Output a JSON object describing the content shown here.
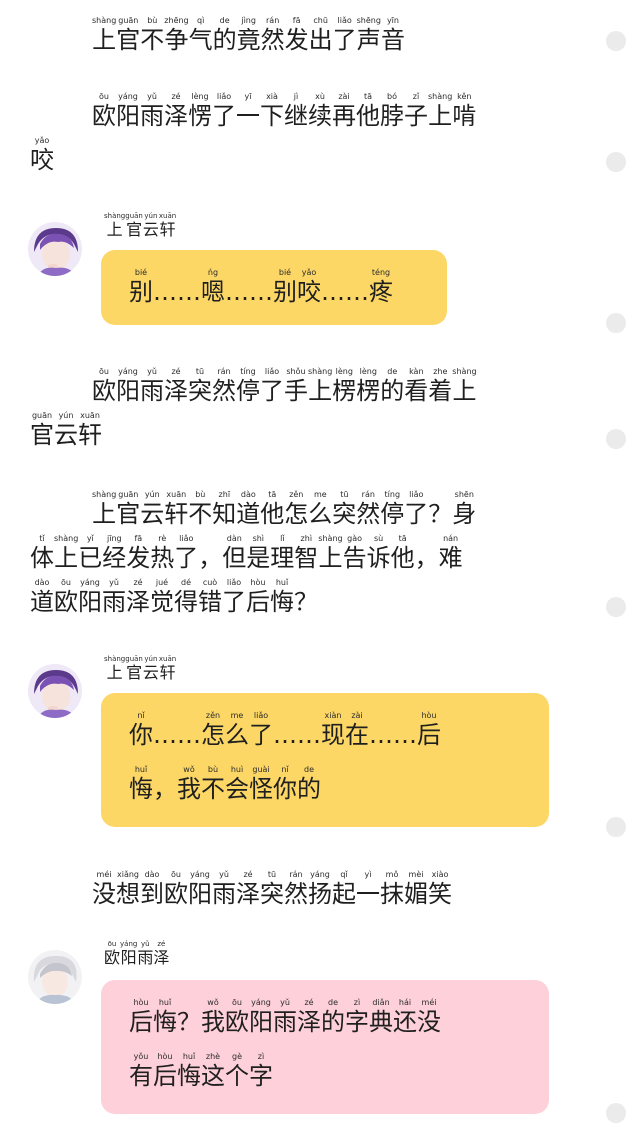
{
  "colors": {
    "bubble_yellow": "#fcd766",
    "bubble_pink": "#fdd0da",
    "scroll_dot": "#ebebeb",
    "text": "#1f1f1f"
  },
  "narration": [
    {
      "lines": [
        [
          [
            "shàng",
            "上"
          ],
          [
            "guān",
            "官"
          ],
          [
            "bù",
            "不"
          ],
          [
            "zhēng",
            "争"
          ],
          [
            "qì",
            "气"
          ],
          [
            "de",
            "的"
          ],
          [
            "jìng",
            "竟"
          ],
          [
            "rán",
            "然"
          ],
          [
            "fā",
            "发"
          ],
          [
            "chū",
            "出"
          ],
          [
            "liǎo",
            "了"
          ],
          [
            "shēng",
            "声"
          ],
          [
            "yīn",
            "音"
          ]
        ]
      ]
    },
    {
      "lines": [
        [
          [
            "ōu",
            "欧"
          ],
          [
            "yáng",
            "阳"
          ],
          [
            "yǔ",
            "雨"
          ],
          [
            "zé",
            "泽"
          ],
          [
            "lèng",
            "愣"
          ],
          [
            "liǎo",
            "了"
          ],
          [
            "yī",
            "一"
          ],
          [
            "xià",
            "下"
          ],
          [
            "jì",
            "继"
          ],
          [
            "xù",
            "续"
          ],
          [
            "zài",
            "再"
          ],
          [
            "tā",
            "他"
          ],
          [
            "bó",
            "脖"
          ],
          [
            "zǐ",
            "子"
          ],
          [
            "shàng",
            "上"
          ],
          [
            "kěn",
            "啃"
          ]
        ],
        [
          [
            "yǎo",
            "咬"
          ]
        ]
      ]
    },
    {
      "lines": [
        [
          [
            "ōu",
            "欧"
          ],
          [
            "yáng",
            "阳"
          ],
          [
            "yǔ",
            "雨"
          ],
          [
            "zé",
            "泽"
          ],
          [
            "tū",
            "突"
          ],
          [
            "rán",
            "然"
          ],
          [
            "tíng",
            "停"
          ],
          [
            "liǎo",
            "了"
          ],
          [
            "shǒu",
            "手"
          ],
          [
            "shàng",
            "上"
          ],
          [
            "lèng",
            "楞"
          ],
          [
            "lèng",
            "楞"
          ],
          [
            "de",
            "的"
          ],
          [
            "kàn",
            "看"
          ],
          [
            "zhe",
            "着"
          ],
          [
            "shàng",
            "上"
          ]
        ],
        [
          [
            "guān",
            "官"
          ],
          [
            "yún",
            "云"
          ],
          [
            "xuān",
            "轩"
          ]
        ]
      ]
    },
    {
      "lines": [
        [
          [
            "shàng",
            "上"
          ],
          [
            "guān",
            "官"
          ],
          [
            "yún",
            "云"
          ],
          [
            "xuān",
            "轩"
          ],
          [
            "bù",
            "不"
          ],
          [
            "zhī",
            "知"
          ],
          [
            "dào",
            "道"
          ],
          [
            "tā",
            "他"
          ],
          [
            "zěn",
            "怎"
          ],
          [
            "me",
            "么"
          ],
          [
            "tū",
            "突"
          ],
          [
            "rán",
            "然"
          ],
          [
            "tíng",
            "停"
          ],
          [
            "liǎo",
            "了"
          ],
          [
            "",
            "？"
          ],
          [
            "shēn",
            "身"
          ]
        ],
        [
          [
            "tǐ",
            "体"
          ],
          [
            "shàng",
            "上"
          ],
          [
            "yǐ",
            "已"
          ],
          [
            "jīng",
            "经"
          ],
          [
            "fā",
            "发"
          ],
          [
            "rè",
            "热"
          ],
          [
            "liǎo",
            "了"
          ],
          [
            "",
            "，"
          ],
          [
            "dàn",
            "但"
          ],
          [
            "shì",
            "是"
          ],
          [
            "lǐ",
            "理"
          ],
          [
            "zhì",
            "智"
          ],
          [
            "shàng",
            "上"
          ],
          [
            "gào",
            "告"
          ],
          [
            "sù",
            "诉"
          ],
          [
            "tā",
            "他"
          ],
          [
            "",
            "，"
          ],
          [
            "nán",
            "难"
          ]
        ],
        [
          [
            "dào",
            "道"
          ],
          [
            "ōu",
            "欧"
          ],
          [
            "yáng",
            "阳"
          ],
          [
            "yǔ",
            "雨"
          ],
          [
            "zé",
            "泽"
          ],
          [
            "jué",
            "觉"
          ],
          [
            "dé",
            "得"
          ],
          [
            "cuò",
            "错"
          ],
          [
            "liǎo",
            "了"
          ],
          [
            "hòu",
            "后"
          ],
          [
            "huǐ",
            "悔"
          ],
          [
            "",
            "？"
          ]
        ]
      ]
    },
    {
      "lines": [
        [
          [
            "méi",
            "没"
          ],
          [
            "xiǎng",
            "想"
          ],
          [
            "dào",
            "到"
          ],
          [
            "ōu",
            "欧"
          ],
          [
            "yáng",
            "阳"
          ],
          [
            "yǔ",
            "雨"
          ],
          [
            "zé",
            "泽"
          ],
          [
            "tū",
            "突"
          ],
          [
            "rán",
            "然"
          ],
          [
            "yáng",
            "扬"
          ],
          [
            "qǐ",
            "起"
          ],
          [
            "yì",
            "一"
          ],
          [
            "mǒ",
            "抹"
          ],
          [
            "mèi",
            "媚"
          ],
          [
            "xiào",
            "笑"
          ]
        ]
      ]
    }
  ],
  "messages": [
    {
      "speaker": [
        [
          "shàng",
          "上"
        ],
        [
          "guān",
          "官"
        ],
        [
          "yún",
          "云"
        ],
        [
          "xuān",
          "轩"
        ]
      ],
      "avatar": "purple-hair-avatar",
      "bubble_color": "yellow",
      "lines": [
        [
          [
            "bié",
            "别"
          ],
          [
            "",
            "……"
          ],
          [
            "ńg",
            "嗯"
          ],
          [
            "",
            "……"
          ],
          [
            "bié",
            "别"
          ],
          [
            "yǎo",
            "咬"
          ],
          [
            "",
            "……"
          ],
          [
            "téng",
            "疼"
          ]
        ]
      ]
    },
    {
      "speaker": [
        [
          "shàng",
          "上"
        ],
        [
          "guān",
          "官"
        ],
        [
          "yún",
          "云"
        ],
        [
          "xuān",
          "轩"
        ]
      ],
      "avatar": "purple-hair-avatar",
      "bubble_color": "yellow",
      "lines": [
        [
          [
            "nǐ",
            "你"
          ],
          [
            "",
            "……"
          ],
          [
            "zěn",
            "怎"
          ],
          [
            "me",
            "么"
          ],
          [
            "liǎo",
            "了"
          ],
          [
            "",
            "……"
          ],
          [
            "xiàn",
            "现"
          ],
          [
            "zài",
            "在"
          ],
          [
            "",
            "……"
          ],
          [
            "hòu",
            "后"
          ]
        ],
        [
          [
            "huǐ",
            "悔"
          ],
          [
            "",
            "，"
          ],
          [
            "wǒ",
            "我"
          ],
          [
            "bù",
            "不"
          ],
          [
            "huì",
            "会"
          ],
          [
            "guài",
            "怪"
          ],
          [
            "nǐ",
            "你"
          ],
          [
            "de",
            "的"
          ]
        ]
      ]
    },
    {
      "speaker": [
        [
          "ōu",
          "欧"
        ],
        [
          "yáng",
          "阳"
        ],
        [
          "yǔ",
          "雨"
        ],
        [
          "zé",
          "泽"
        ]
      ],
      "avatar": "white-hair-avatar",
      "bubble_color": "pink",
      "lines": [
        [
          [
            "hòu",
            "后"
          ],
          [
            "huǐ",
            "悔"
          ],
          [
            "",
            "？"
          ],
          [
            "wǒ",
            "我"
          ],
          [
            "ōu",
            "欧"
          ],
          [
            "yáng",
            "阳"
          ],
          [
            "yǔ",
            "雨"
          ],
          [
            "zé",
            "泽"
          ],
          [
            "de",
            "的"
          ],
          [
            "zì",
            "字"
          ],
          [
            "diǎn",
            "典"
          ],
          [
            "hái",
            "还"
          ],
          [
            "méi",
            "没"
          ]
        ],
        [
          [
            "yǒu",
            "有"
          ],
          [
            "hòu",
            "后"
          ],
          [
            "huǐ",
            "悔"
          ],
          [
            "zhè",
            "这"
          ],
          [
            "gè",
            "个"
          ],
          [
            "zì",
            "字"
          ]
        ]
      ]
    }
  ]
}
